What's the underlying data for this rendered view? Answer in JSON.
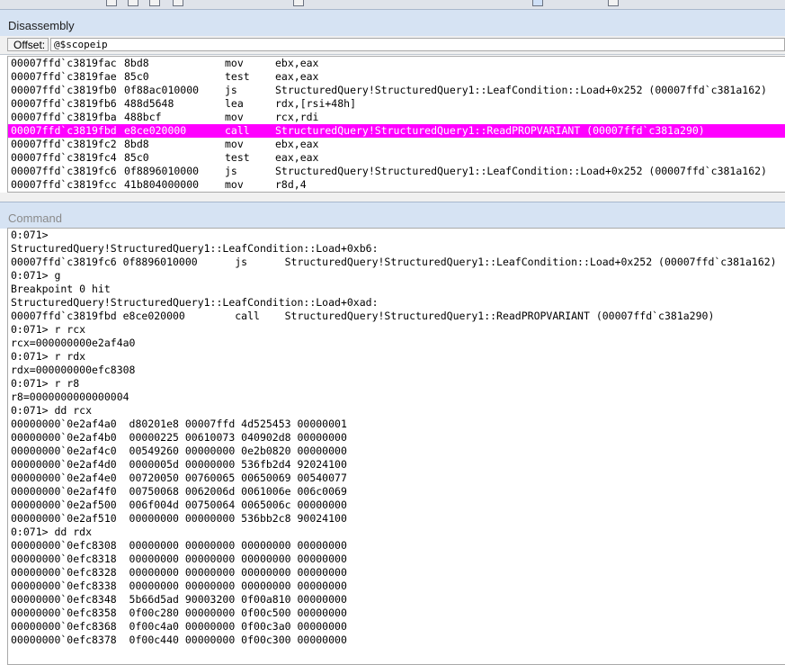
{
  "disassembly": {
    "title": "Disassembly",
    "offset_label": "Offset:",
    "offset_value": "@$scopeip",
    "rows": [
      {
        "addr": "00007ffd`c3819fac",
        "bytes": "8bd8",
        "mnemonic": "mov",
        "operands": "ebx,eax",
        "highlighted": false
      },
      {
        "addr": "00007ffd`c3819fae",
        "bytes": "85c0",
        "mnemonic": "test",
        "operands": "eax,eax",
        "highlighted": false
      },
      {
        "addr": "00007ffd`c3819fb0",
        "bytes": "0f88ac010000",
        "mnemonic": "js",
        "operands": "StructuredQuery!StructuredQuery1::LeafCondition::Load+0x252 (00007ffd`c381a162)",
        "highlighted": false
      },
      {
        "addr": "00007ffd`c3819fb6",
        "bytes": "488d5648",
        "mnemonic": "lea",
        "operands": "rdx,[rsi+48h]",
        "highlighted": false
      },
      {
        "addr": "00007ffd`c3819fba",
        "bytes": "488bcf",
        "mnemonic": "mov",
        "operands": "rcx,rdi",
        "highlighted": false
      },
      {
        "addr": "00007ffd`c3819fbd",
        "bytes": "e8ce020000",
        "mnemonic": "call",
        "operands": "StructuredQuery!StructuredQuery1::ReadPROPVARIANT (00007ffd`c381a290)",
        "highlighted": true
      },
      {
        "addr": "00007ffd`c3819fc2",
        "bytes": "8bd8",
        "mnemonic": "mov",
        "operands": "ebx,eax",
        "highlighted": false
      },
      {
        "addr": "00007ffd`c3819fc4",
        "bytes": "85c0",
        "mnemonic": "test",
        "operands": "eax,eax",
        "highlighted": false
      },
      {
        "addr": "00007ffd`c3819fc6",
        "bytes": "0f8896010000",
        "mnemonic": "js",
        "operands": "StructuredQuery!StructuredQuery1::LeafCondition::Load+0x252 (00007ffd`c381a162)",
        "highlighted": false
      },
      {
        "addr": "00007ffd`c3819fcc",
        "bytes": "41b804000000",
        "mnemonic": "mov",
        "operands": "r8d,4",
        "highlighted": false
      }
    ]
  },
  "command": {
    "title": "Command",
    "lines": [
      "0:071>",
      "StructuredQuery!StructuredQuery1::LeafCondition::Load+0xb6:",
      "00007ffd`c3819fc6 0f8896010000      js      StructuredQuery!StructuredQuery1::LeafCondition::Load+0x252 (00007ffd`c381a162) [",
      "0:071> g",
      "Breakpoint 0 hit",
      "StructuredQuery!StructuredQuery1::LeafCondition::Load+0xad:",
      "00007ffd`c3819fbd e8ce020000        call    StructuredQuery!StructuredQuery1::ReadPROPVARIANT (00007ffd`c381a290)",
      "0:071> r rcx",
      "rcx=000000000e2af4a0",
      "0:071> r rdx",
      "rdx=000000000efc8308",
      "0:071> r r8",
      "r8=0000000000000004",
      "0:071> dd rcx",
      "00000000`0e2af4a0  d80201e8 00007ffd 4d525453 00000001",
      "00000000`0e2af4b0  00000225 00610073 040902d8 00000000",
      "00000000`0e2af4c0  00549260 00000000 0e2b0820 00000000",
      "00000000`0e2af4d0  0000005d 00000000 536fb2d4 92024100",
      "00000000`0e2af4e0  00720050 00760065 00650069 00540077",
      "00000000`0e2af4f0  00750068 0062006d 0061006e 006c0069",
      "00000000`0e2af500  006f004d 00750064 0065006c 00000000",
      "00000000`0e2af510  00000000 00000000 536bb2c8 90024100",
      "0:071> dd rdx",
      "00000000`0efc8308  00000000 00000000 00000000 00000000",
      "00000000`0efc8318  00000000 00000000 00000000 00000000",
      "00000000`0efc8328  00000000 00000000 00000000 00000000",
      "00000000`0efc8338  00000000 00000000 00000000 00000000",
      "00000000`0efc8348  5b66d5ad 90003200 0f00a810 00000000",
      "00000000`0efc8358  0f00c280 00000000 0f00c500 00000000",
      "00000000`0efc8368  0f00c4a0 00000000 0f00c3a0 00000000",
      "00000000`0efc8378  0f00c440 00000000 0f00c300 00000000"
    ]
  },
  "colors": {
    "highlight": "#ff00ff",
    "panel_title_bg": "#d6e3f3"
  }
}
